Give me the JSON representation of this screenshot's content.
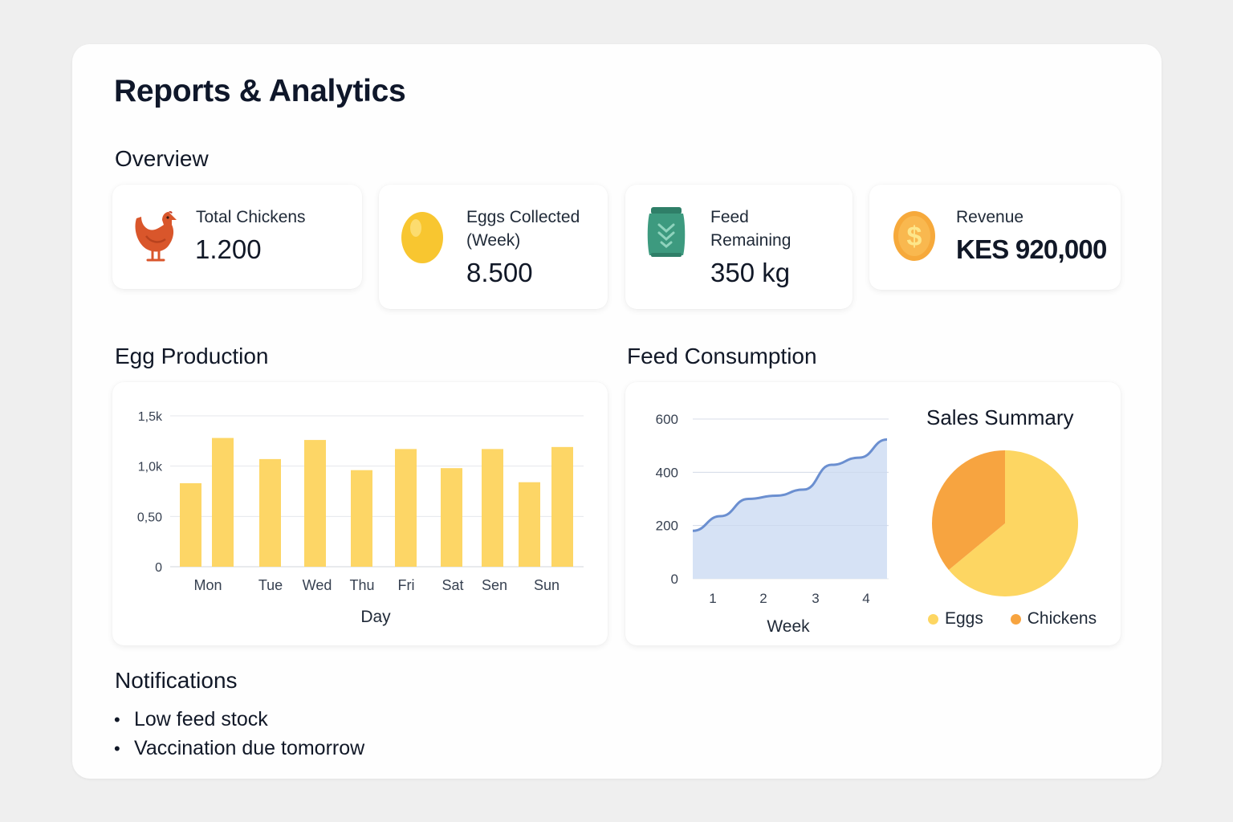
{
  "page": {
    "title": "Reports & Analytics"
  },
  "overview": {
    "title": "Overview",
    "cards": [
      {
        "label": "Total Chickens",
        "value": "1.200",
        "icon": "chicken-icon"
      },
      {
        "label_line1": "Eggs Collected",
        "label_line2": "(Week)",
        "value": "8.500",
        "icon": "egg-icon"
      },
      {
        "label_line1": "Feed",
        "label_line2": "Remaining",
        "value": "350 kg",
        "icon": "feed-bag-icon"
      },
      {
        "label": "Revenue",
        "value": "KES 920,000",
        "icon": "dollar-coin-icon"
      }
    ]
  },
  "colors": {
    "bar": "#fdd666",
    "line": "#6b8fd0",
    "area": "#d4e0f4",
    "pie_eggs": "#fdd662",
    "pie_chickens": "#f7a440",
    "chicken": "#d9562b",
    "egg": "#f8c630",
    "feed_bag": "#3d9a7f",
    "coin": "#f6a93b"
  },
  "egg_production": {
    "title": "Egg Production",
    "chart_data": {
      "type": "bar",
      "xlabel": "Day",
      "ylabel": "",
      "ylim": [
        0,
        1.5
      ],
      "yticks": [
        0,
        0.5,
        1.0,
        1.5
      ],
      "ytick_labels": [
        "0",
        "0,50",
        "1,0k",
        "1,5k"
      ],
      "categories": [
        "Mon",
        "Tue",
        "Wed",
        "Thu",
        "Fri",
        "Sat",
        "Sen",
        "Sun"
      ],
      "values": [
        0.83,
        1.28,
        1.07,
        1.26,
        0.96,
        1.17,
        0.98,
        1.17,
        0.84,
        1.19
      ],
      "grid": true
    }
  },
  "feed_consumption": {
    "title": "Feed Consumption",
    "chart_data": {
      "type": "area",
      "xlabel": "Week",
      "ylabel": "",
      "ylim": [
        0,
        600
      ],
      "yticks": [
        0,
        200,
        400,
        600
      ],
      "x": [
        1,
        1.5,
        2,
        2.5,
        3,
        3.5,
        4,
        4.5
      ],
      "y": [
        180,
        235,
        300,
        312,
        335,
        428,
        455,
        523
      ],
      "xticks": [
        1,
        2,
        3,
        4
      ],
      "grid": true
    }
  },
  "sales_summary": {
    "title": "Sales Summary",
    "chart_data": {
      "type": "pie",
      "labels": [
        "Eggs",
        "Chickens"
      ],
      "values": [
        64,
        36
      ]
    }
  },
  "notifications": {
    "title": "Notifications",
    "items": [
      "Low feed stock",
      "Vaccination due tomorrow"
    ]
  }
}
